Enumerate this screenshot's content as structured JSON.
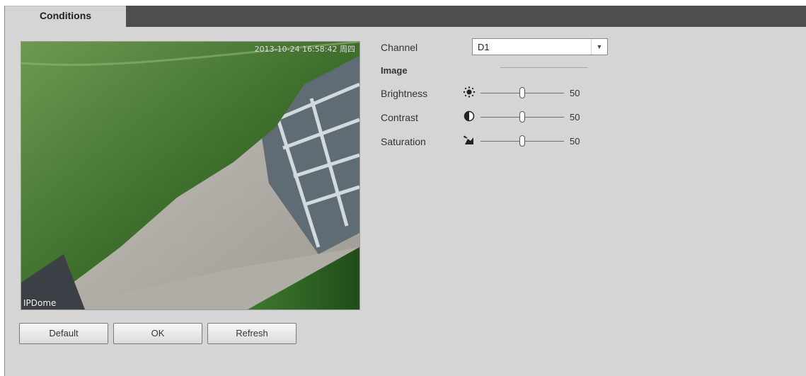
{
  "tabs": [
    {
      "label": "Conditions"
    }
  ],
  "preview": {
    "timestamp": "2013-10-24 16:58:42 周四",
    "channel_name": "IPDome"
  },
  "settings": {
    "channel": {
      "label": "Channel",
      "value": "D1"
    },
    "section_title": "Image",
    "sliders": [
      {
        "label": "Brightness",
        "value": "50",
        "level": 0.5,
        "icon": "brightness-icon"
      },
      {
        "label": "Contrast",
        "value": "50",
        "level": 0.5,
        "icon": "contrast-icon"
      },
      {
        "label": "Saturation",
        "value": "50",
        "level": 0.5,
        "icon": "saturation-icon"
      }
    ]
  },
  "buttons": {
    "default": "Default",
    "ok": "OK",
    "refresh": "Refresh"
  }
}
